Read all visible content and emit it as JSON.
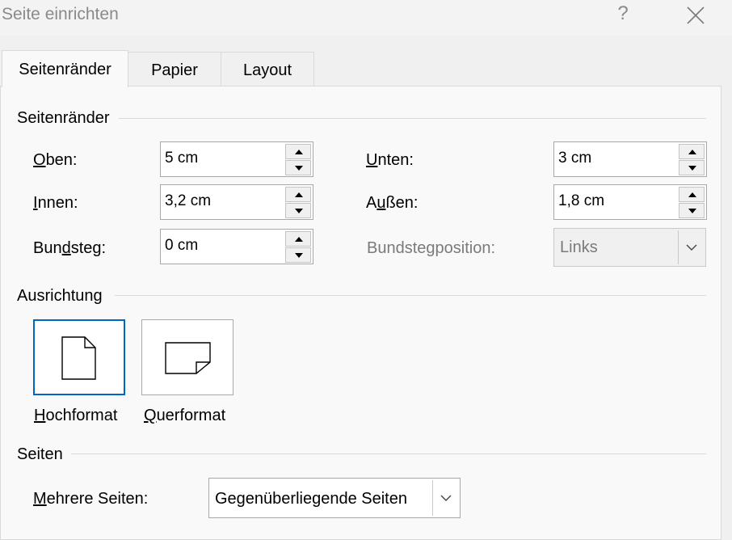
{
  "window": {
    "title": "Seite einrichten",
    "help": "?"
  },
  "tabs": [
    {
      "label": "Seitenränder",
      "active": true
    },
    {
      "label": "Papier",
      "active": false
    },
    {
      "label": "Layout",
      "active": false
    }
  ],
  "margins": {
    "group_label": "Seitenränder",
    "top": {
      "mnemonic": "O",
      "rest": "ben:",
      "value": "5 cm"
    },
    "bottom": {
      "mnemonic": "U",
      "rest": "nten:",
      "value": "3 cm"
    },
    "inside": {
      "mnemonic": "I",
      "rest": "nnen:",
      "value": "3,2 cm"
    },
    "outside": {
      "pre": "A",
      "mnemonic": "u",
      "rest": "ßen:",
      "value": "1,8 cm"
    },
    "gutter": {
      "pre": "Bun",
      "mnemonic": "d",
      "rest": "steg:",
      "value": "0 cm"
    },
    "gutter_position": {
      "label": "Bundstegposition:",
      "value": "Links"
    }
  },
  "orientation": {
    "group_label": "Ausrichtung",
    "portrait": {
      "mnemonic": "H",
      "rest": "ochformat",
      "selected": true
    },
    "landscape": {
      "mnemonic": "Q",
      "rest": "uerformat",
      "selected": false
    }
  },
  "pages": {
    "group_label": "Seiten",
    "multiple": {
      "mnemonic": "M",
      "rest": "ehrere Seiten:",
      "value": "Gegenüberliegende Seiten"
    }
  },
  "colors": {
    "accent": "#0067c0",
    "panel": "#f9f9f9",
    "window": "#f0f0f0"
  }
}
